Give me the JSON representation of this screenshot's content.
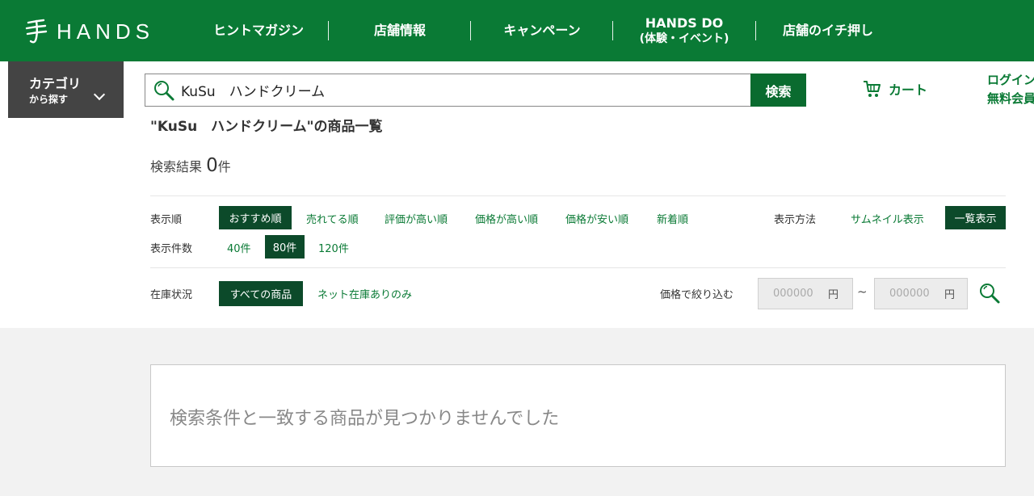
{
  "header": {
    "logo_text": "HANDS",
    "nav": [
      {
        "label": "ヒントマガジン"
      },
      {
        "label": "店舗情報"
      },
      {
        "label": "キャンペーン"
      },
      {
        "label": "HANDS DO",
        "sub": "(体験・イベント)"
      },
      {
        "label": "店舗のイチ押し"
      }
    ],
    "brand_color": "#0a7a35"
  },
  "category": {
    "line1": "カテゴリ",
    "line2": "から探す"
  },
  "search": {
    "value": "KuSu　ハンドクリーム",
    "button": "検索"
  },
  "cart": {
    "label": "カート"
  },
  "login": {
    "line1": "ログイン",
    "line2": "無料会員"
  },
  "results": {
    "title": "\"KuSu　ハンドクリーム\"の商品一覧",
    "count_label": "検索結果",
    "count": "0",
    "count_unit": "件"
  },
  "sort": {
    "label": "表示順",
    "options": [
      "おすすめ順",
      "売れてる順",
      "評価が高い順",
      "価格が高い順",
      "価格が安い順",
      "新着順"
    ]
  },
  "view": {
    "label": "表示方法",
    "options": [
      "サムネイル表示",
      "一覧表示"
    ]
  },
  "per_page": {
    "label": "表示件数",
    "options": [
      "40件",
      "80件",
      "120件"
    ]
  },
  "stock": {
    "label": "在庫状況",
    "options": [
      "すべての商品",
      "ネット在庫ありのみ"
    ]
  },
  "price_filter": {
    "label": "価格で絞り込む",
    "min_placeholder": "000000",
    "max_placeholder": "000000",
    "unit": "円",
    "separator": "~"
  },
  "empty_message": "検索条件と一致する商品が見つかりませんでした"
}
